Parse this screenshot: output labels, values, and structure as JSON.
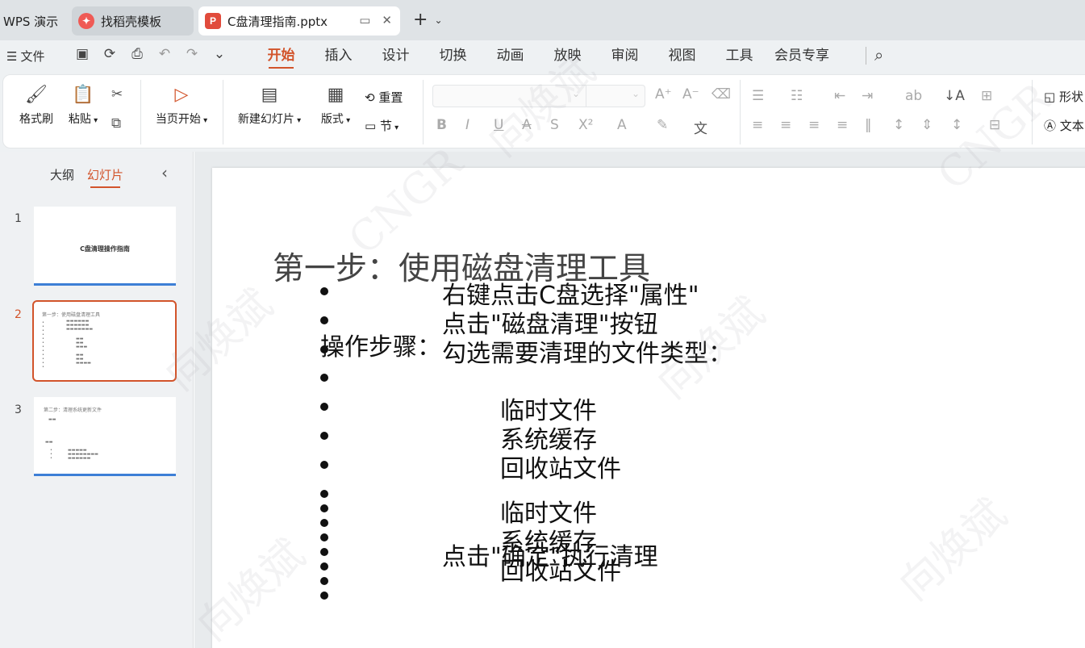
{
  "tabs": {
    "wps": "WPS 演示",
    "template": "找稻壳模板",
    "document": "C盘清理指南.pptx",
    "doc_icon": "P"
  },
  "menu": {
    "file": "文件",
    "tabs": [
      "开始",
      "插入",
      "设计",
      "切换",
      "动画",
      "放映",
      "审阅",
      "视图",
      "工具",
      "会员专享"
    ],
    "active_tab": "开始"
  },
  "ribbon": {
    "format_painter": "格式刷",
    "paste": "粘贴",
    "play_from_current": "当页开始",
    "new_slide": "新建幻灯片",
    "layout": "版式",
    "reset": "重置",
    "section": "节",
    "shape": "形状",
    "textbox": "文本"
  },
  "sidebar": {
    "outline_tab": "大纲",
    "slides_tab": "幻灯片",
    "slides": [
      {
        "num": "1",
        "title": "C盘清理操作指南"
      },
      {
        "num": "2",
        "title": "第一步：使用磁盘清理工具"
      },
      {
        "num": "3",
        "title": "第二步：清理系统更新文件"
      }
    ]
  },
  "slide": {
    "title": "第一步：使用磁盘清理工具",
    "label": "操作步骤：",
    "steps": [
      "右键点击C盘选择\"属性\"",
      "点击\"磁盘清理\"按钮",
      "勾选需要清理的文件类型："
    ],
    "list_a": [
      "临时文件",
      "系统缓存",
      "回收站文件"
    ],
    "list_b": [
      "临时文件",
      "系统缓存",
      "回收站文件"
    ],
    "confirm": "点击\"确定\"执行清理"
  },
  "watermark": "向焕斌",
  "watermark_alt": "CNGR",
  "colors": {
    "accent": "#d2542b",
    "thumb_bar": "#3d7fd6"
  }
}
